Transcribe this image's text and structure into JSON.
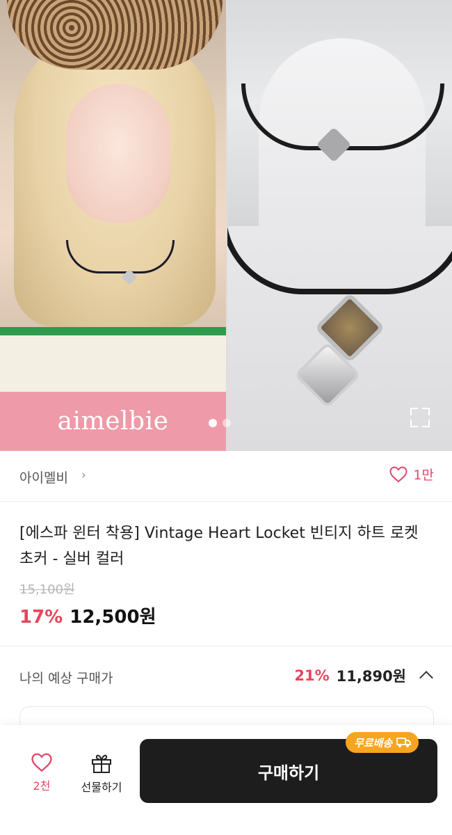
{
  "gallery": {
    "brand_caption": "aimelbie",
    "dots_total": 2,
    "dots_active": 1,
    "expand_icon": "expand-icon"
  },
  "shop": {
    "name": "아이멜비",
    "chevron": "›",
    "likes": "1만"
  },
  "product": {
    "title": "[에스파 윈터 착용] Vintage Heart Locket 빈티지 하트 로켓 초커 - 실버 컬러",
    "original_price": "15,100원",
    "discount": "17%",
    "price": "12,500원"
  },
  "expected": {
    "label": "나의 예상 구매가",
    "discount": "21%",
    "price": "11,890원"
  },
  "bottom_bar": {
    "wish_count": "2천",
    "gift_label": "선물하기",
    "buy_label": "구매하기",
    "free_shipping": "무료배송"
  },
  "colors": {
    "accent_red": "#e8455c",
    "brand_pink": "#ef9aa8",
    "badge_orange": "#f7a520",
    "buy_button": "#1d1d1d"
  }
}
